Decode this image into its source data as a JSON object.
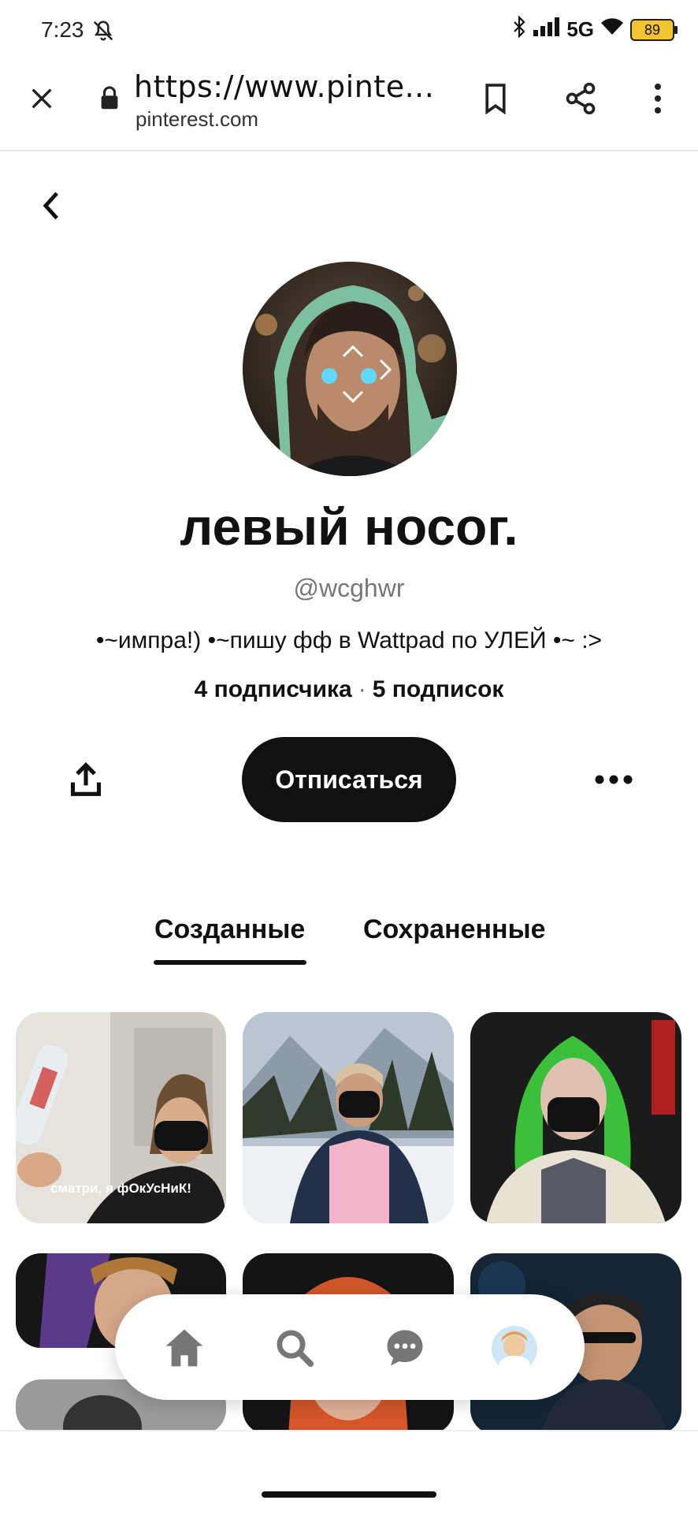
{
  "status_bar": {
    "time": "7:23",
    "network": "5G",
    "battery": "89"
  },
  "browser": {
    "url": "https://www.pinte...",
    "domain": "pinterest.com",
    "icons": [
      "close-icon",
      "lock-icon",
      "bookmark-icon",
      "share-icon",
      "more-vert-icon"
    ]
  },
  "profile": {
    "name": "левый носог.",
    "handle": "@wcghwr",
    "bio": "•~импра!) •~пишу фф в Wattpad по УЛЕЙ •~ :>",
    "followers": "4 подписчика",
    "separator": "·",
    "following": "5 подписок",
    "unfollow_label": "Отписаться"
  },
  "tabs": [
    {
      "label": "Созданные",
      "active": true
    },
    {
      "label": "Сохраненные",
      "active": false
    }
  ],
  "pins": [
    {
      "caption": "сматри, я фОкУсНиК!"
    },
    {
      "caption": ""
    },
    {
      "caption": ""
    },
    {
      "caption": ""
    },
    {
      "caption": ""
    },
    {
      "caption": ""
    }
  ],
  "bottom_nav": [
    "home-icon",
    "search-icon",
    "messages-icon",
    "profile-avatar"
  ],
  "colors": {
    "primary": "#111111",
    "muted": "#777777",
    "background": "#ffffff",
    "battery": "#f4c430"
  }
}
